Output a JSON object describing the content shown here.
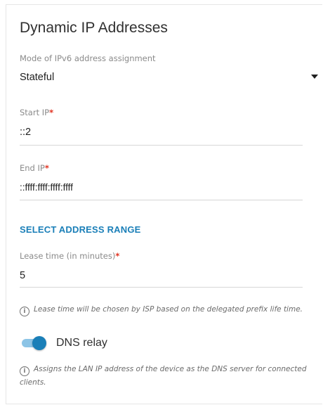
{
  "section": {
    "title": "Dynamic IP Addresses"
  },
  "mode": {
    "label": "Mode of IPv6 address assignment",
    "value": "Stateful"
  },
  "start_ip": {
    "label": "Start IP",
    "required_mark": "*",
    "value": "::2"
  },
  "end_ip": {
    "label": "End IP",
    "required_mark": "*",
    "value": "::ffff:ffff:ffff:ffff"
  },
  "select_range": {
    "label": "SELECT ADDRESS RANGE"
  },
  "lease": {
    "label": "Lease time (in minutes)",
    "required_mark": "*",
    "value": "5",
    "note": "Lease time will be chosen by ISP based on the delegated prefix life time."
  },
  "dns_relay": {
    "label": "DNS relay",
    "enabled": true,
    "note": "Assigns the LAN IP address of the device as the DNS server for connected clients."
  },
  "colors": {
    "accent": "#1a7fb8",
    "required": "#e0301e"
  },
  "icons": {
    "info": "info-icon",
    "dropdown": "chevron-down-icon"
  }
}
